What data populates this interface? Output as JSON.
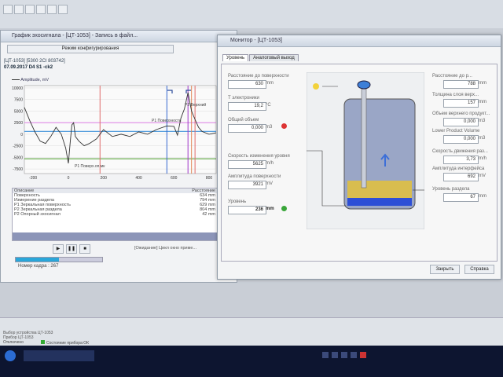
{
  "colors": {
    "accent": "#2b6cd4",
    "tank_fill": "#d8bd4f",
    "tank_bottom": "#2d4fd6",
    "taskbar": "#0d1530"
  },
  "window_left": {
    "title": "График эхосигнала - [ЦТ-1053] - Запись в файл...",
    "mode_button": "Режим конфигурирования",
    "device_line": "[ЦТ-1053] [5300 2CI 803742]",
    "date_line": "07.09.2017 D4 S1 -ck2",
    "legend_label": "Amplitude, mV",
    "markers": [
      "P2 Верхний",
      "P1 Поверхность",
      "P1 Поверх.оп.мк"
    ],
    "table": {
      "header": [
        "Описание",
        "Расстояние"
      ],
      "rows": [
        [
          "Поверхность",
          "634 mm"
        ],
        [
          "Измерение раздела",
          "794 mm"
        ],
        [
          "P1 Зеркальная поверхность",
          "629 mm"
        ],
        [
          "P2 Зеркальная раздела",
          "804 mm"
        ],
        [
          "P2 Опорный эхосигнал",
          "42 mm"
        ]
      ]
    },
    "status_note": "[Ожидание] Цикл окно приме...",
    "progress_label": "Номер кадра : 267",
    "progress": 0.5
  },
  "chart_data": {
    "type": "line",
    "ylabel": "Amplitude, mV",
    "yticks": [
      10000,
      7500,
      5000,
      2500,
      0,
      -2500,
      -5000,
      -7500
    ],
    "xticks": [
      -200,
      0,
      200,
      400,
      600,
      800
    ],
    "ylim": [
      -8500,
      10500
    ],
    "xlim": [
      -250,
      840
    ],
    "series": [
      {
        "x": [
          -250,
          -220,
          -190,
          -160,
          -130,
          -100,
          -70,
          -40,
          -15,
          0,
          10,
          20,
          30,
          40,
          60,
          90,
          120,
          160,
          200,
          250,
          300,
          350,
          400,
          450,
          500,
          560,
          600,
          620,
          640,
          660,
          680,
          700,
          720,
          740,
          760,
          800,
          840
        ],
        "y": [
          5800,
          3000,
          500,
          -1500,
          -2000,
          -500,
          1500,
          0,
          -3000,
          -6300,
          -2000,
          2000,
          2500,
          -500,
          -1500,
          -2500,
          -2000,
          -1000,
          1000,
          -500,
          0,
          -500,
          500,
          0,
          1000,
          1800,
          1700,
          -200,
          3500,
          5500,
          9000,
          5000,
          3200,
          1500,
          600,
          0,
          300
        ]
      }
    ],
    "thresholds": [
      {
        "y": 2500,
        "color": "#e08ae6"
      },
      {
        "y": -5300,
        "color": "#4a9a2c"
      },
      {
        "y": 600,
        "color": "#3a8fd8"
      }
    ],
    "markers": [
      {
        "x": 180,
        "color": "#e06b6b"
      },
      {
        "x": 560,
        "color": "#3465d0"
      },
      {
        "x": 680,
        "color": "#a037c9"
      },
      {
        "x": 700,
        "color": "#e2885a"
      },
      {
        "x": 720,
        "color": "#e06b6b"
      }
    ]
  },
  "window_right": {
    "title": "Монитор - [ЦТ-1053]",
    "tabs": [
      "Уровень",
      "Аналоговый выход"
    ],
    "left_fields": [
      {
        "label": "Расстояние до поверхности",
        "value": "630",
        "unit": "mm"
      },
      {
        "label": "Т электроники",
        "value": "19,2",
        "unit": "°C"
      },
      {
        "label": "Общий объем",
        "value": "0,000",
        "unit": "m3"
      },
      {
        "label": "Скорость изменения уровня",
        "value": "5625",
        "unit": "m/h"
      },
      {
        "label": "Амплитуда поверхности",
        "value": "3921",
        "unit": "mV"
      },
      {
        "label": "Уровень",
        "value": "236",
        "unit": "mm"
      }
    ],
    "right_fields": [
      {
        "label": "Расстояние до р...",
        "value": "788",
        "unit": "mm"
      },
      {
        "label": "Толщина слоя верх...",
        "value": "157",
        "unit": "mm"
      },
      {
        "label": "Объем верхнего продукт...",
        "value": "0,000",
        "unit": "m3"
      },
      {
        "label": "Lower Product Volume",
        "value": "0,000",
        "unit": "m3"
      },
      {
        "label": "Скорость движения раз...",
        "value": "3,73",
        "unit": "m/h"
      },
      {
        "label": "Амплитуда интерфейса",
        "value": "692",
        "unit": "mV"
      },
      {
        "label": "Уровень раздела",
        "value": "67",
        "unit": "mm"
      }
    ],
    "buttons": [
      "Закрыть",
      "Справка"
    ]
  },
  "status_bar": {
    "lines": [
      "Выбор устройства ЦТ-1053",
      "Прибор ЦТ-1053"
    ],
    "items": [
      "Отключено",
      "Состояние прибора:ОК"
    ]
  }
}
